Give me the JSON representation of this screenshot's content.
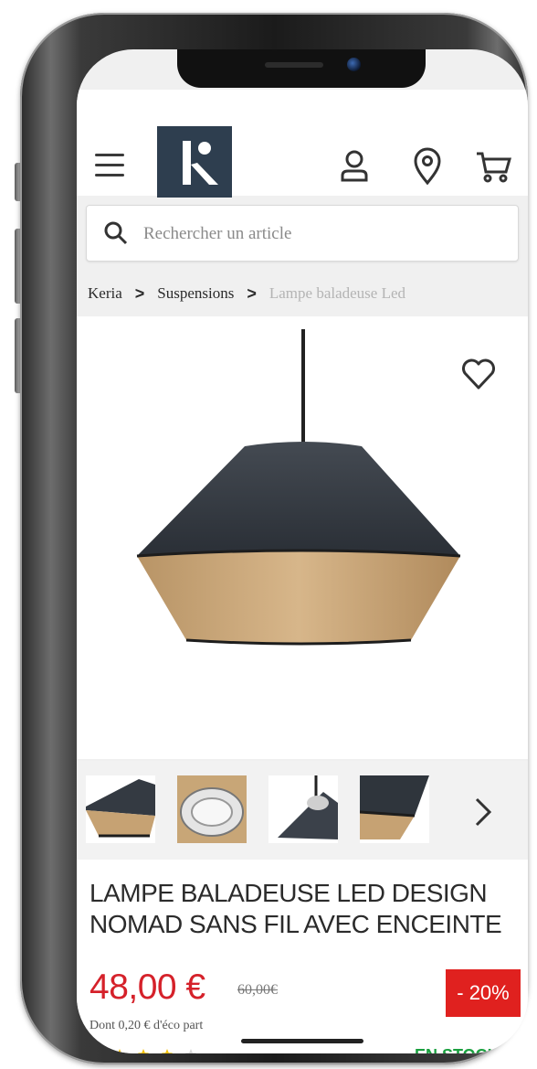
{
  "header": {
    "logo_letter": "K",
    "logo_color": "#2e3e4f"
  },
  "search": {
    "placeholder": "Rechercher un article"
  },
  "breadcrumb": {
    "items": [
      "Keria",
      "Suspensions",
      "Lampe baladeuse Led"
    ],
    "separator": ">"
  },
  "product": {
    "title_line1": "LAMPE BALADEUSE LED DESIGN",
    "title_line2": "NOMAD SANS FIL AVEC ENCEINTE",
    "price": "48,00 €",
    "old_price": "60,00€",
    "eco_part": "Dont 0,20 € d'éco part",
    "discount": "- 20%",
    "stock": "EN STOCK",
    "rating_stars_filled": 4,
    "rating_stars_total": 5,
    "price_color": "#d5212a",
    "stock_color": "#1aa03f",
    "discount_color": "#e0211f"
  },
  "gallery": {
    "thumbnail_count": 4
  },
  "icons": {
    "menu": "menu-icon",
    "account": "account-icon",
    "store": "location-pin-icon",
    "cart": "cart-icon",
    "search": "search-icon",
    "favorite": "heart-icon",
    "next": "chevron-right-icon"
  }
}
